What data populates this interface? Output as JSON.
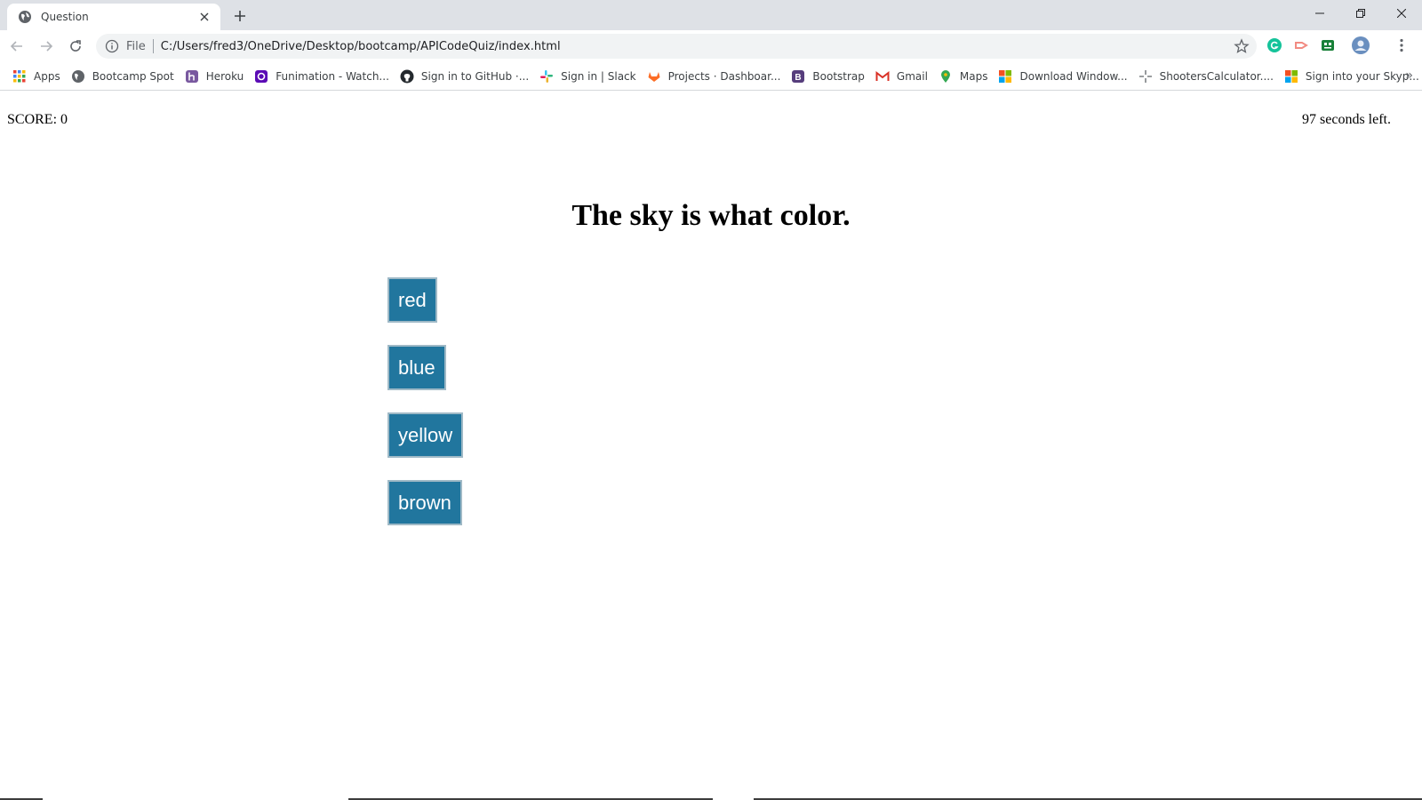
{
  "browser": {
    "tab_title": "Question",
    "omnibox_file_label": "File",
    "url": "C:/Users/fred3/OneDrive/Desktop/bootcamp/APICodeQuiz/index.html",
    "bookmarks": [
      {
        "label": "Apps",
        "icon": "apps-grid-icon",
        "color": "#4285f4"
      },
      {
        "label": "Bootcamp Spot",
        "icon": "globe-icon",
        "color": "#5f6368"
      },
      {
        "label": "Heroku",
        "icon": "heroku-icon",
        "color": "#79589f"
      },
      {
        "label": "Funimation - Watch...",
        "icon": "funimation-icon",
        "color": "#5b0bb5"
      },
      {
        "label": "Sign in to GitHub ·...",
        "icon": "github-icon",
        "color": "#24292e"
      },
      {
        "label": "Sign in | Slack",
        "icon": "slack-icon",
        "color": "#e01e5a"
      },
      {
        "label": "Projects · Dashboar...",
        "icon": "gitlab-icon",
        "color": "#fc6d26"
      },
      {
        "label": "Bootstrap",
        "icon": "bootstrap-icon",
        "color": "#563d7c"
      },
      {
        "label": "Gmail",
        "icon": "gmail-icon",
        "color": "#d93025"
      },
      {
        "label": "Maps",
        "icon": "maps-pin-icon",
        "color": "#34a853"
      },
      {
        "label": "Download Window...",
        "icon": "windows-logo-icon",
        "color": "#f25022"
      },
      {
        "label": "ShootersCalculator....",
        "icon": "crosshair-icon",
        "color": "#5f6368"
      },
      {
        "label": "Sign into your Skyp...",
        "icon": "windows-logo-icon",
        "color": "#f25022"
      }
    ],
    "more_bookmarks": "»"
  },
  "quiz": {
    "score_label": "SCORE: 0",
    "timer_text": "97 seconds left.",
    "question": "The sky is what color.",
    "answers": [
      "red",
      "blue",
      "yellow",
      "brown"
    ],
    "button_color": "#21769e"
  }
}
